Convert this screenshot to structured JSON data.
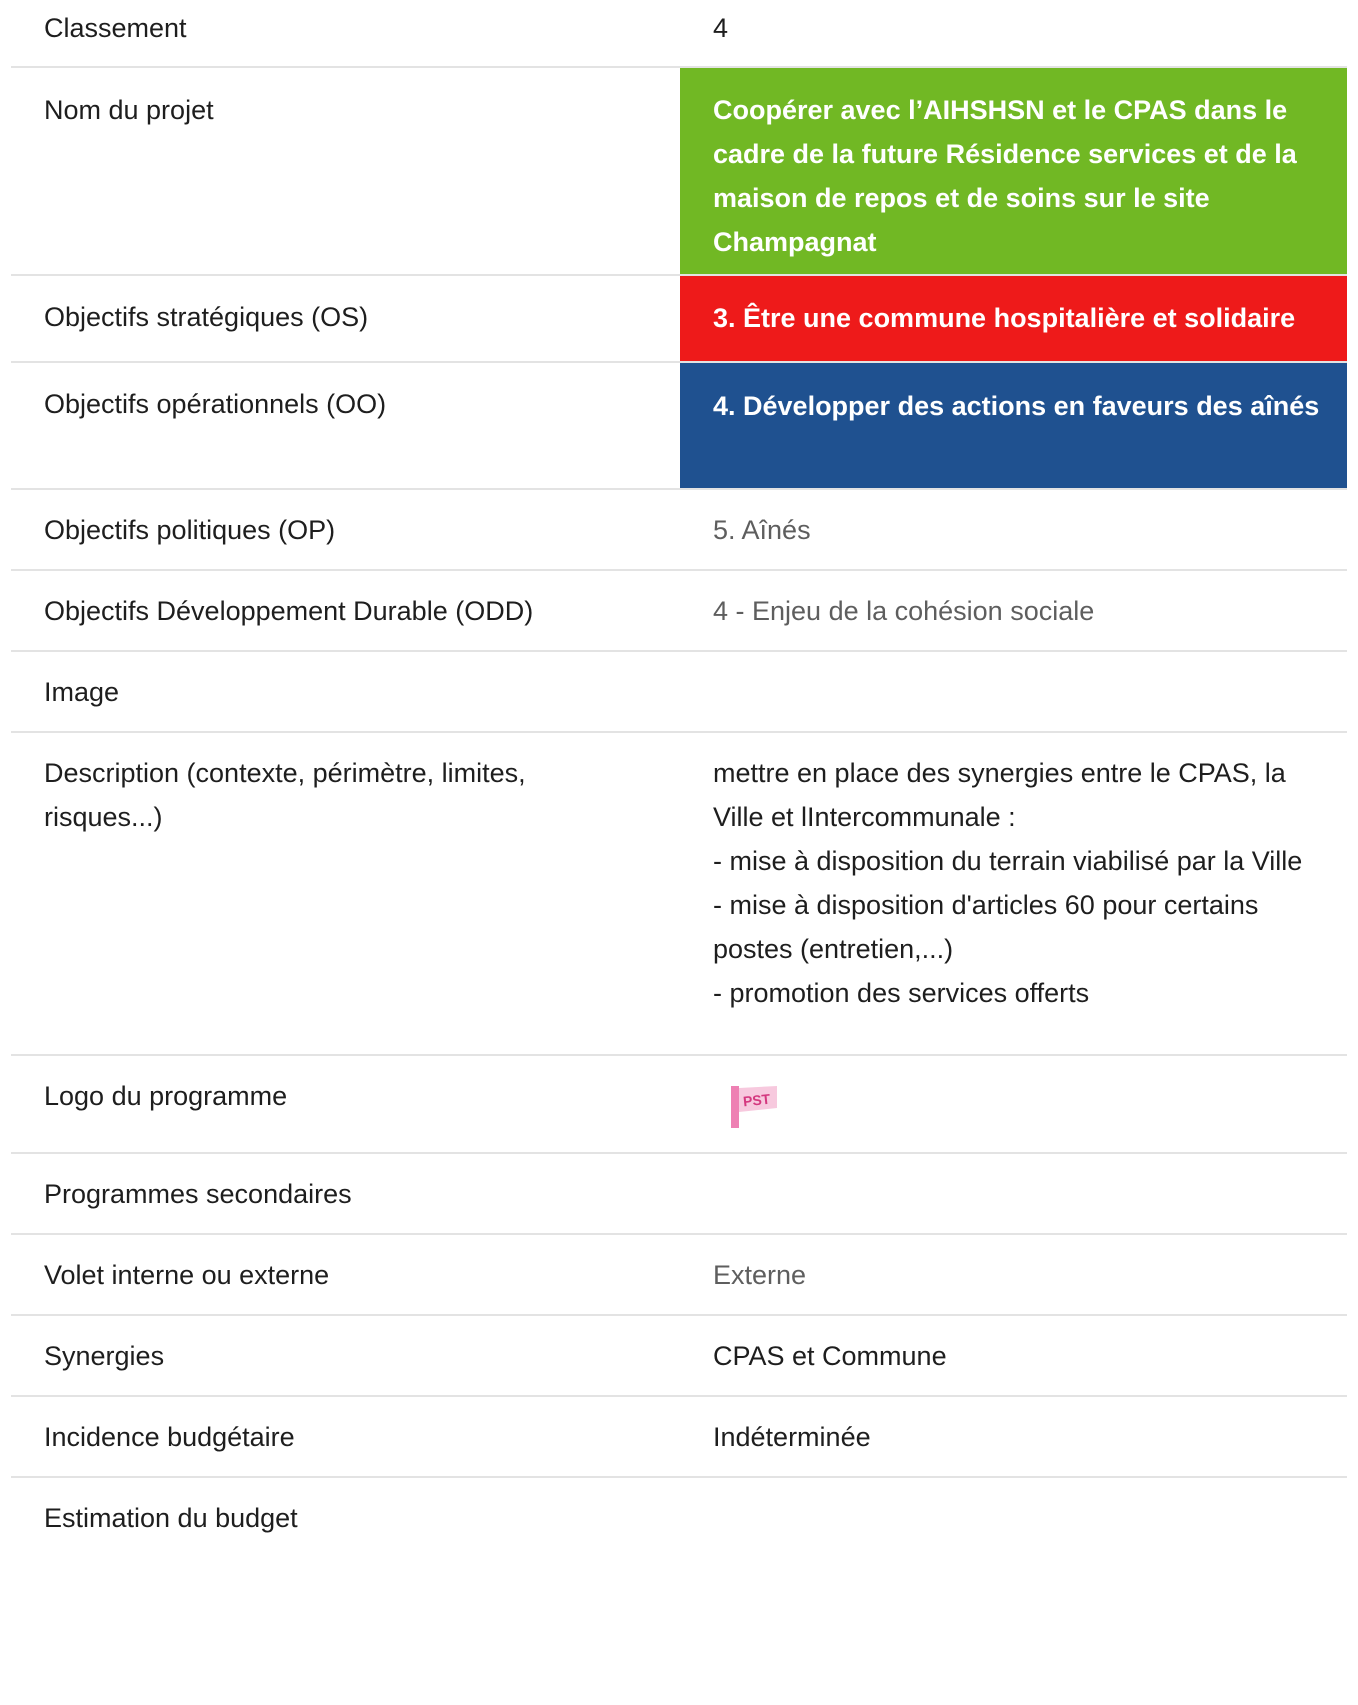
{
  "rows": [
    {
      "label": "Classement",
      "value": "4"
    },
    {
      "label": "Nom du projet",
      "value": "Coopérer avec l’AIHSHSN et le CPAS dans le cadre de la future Résidence services et de la maison de repos et de soins sur le site Champagnat"
    },
    {
      "label": "Objectifs stratégiques (OS)",
      "value": "3. Être une commune hospitalière et solidaire"
    },
    {
      "label": "Objectifs opérationnels (OO)",
      "value": "4. Développer des actions en faveurs des aînés"
    },
    {
      "label": "Objectifs politiques (OP)",
      "value": "5. Aînés"
    },
    {
      "label": "Objectifs Développement Durable (ODD)",
      "value": "4 - Enjeu de la cohésion sociale"
    },
    {
      "label": "Image",
      "value": ""
    },
    {
      "label": "Description (contexte, périmètre, limites, risques...)",
      "value_lines": [
        "mettre en place des synergies entre le CPAS, la Ville et lIntercommunale :",
        "- mise à disposition du terrain viabilisé par la Ville",
        "- mise à disposition d'articles 60 pour certains postes (entretien,...)",
        "- promotion des services offerts"
      ]
    },
    {
      "label": "Logo du programme",
      "logo_text": "PST"
    },
    {
      "label": "Programmes secondaires",
      "value": ""
    },
    {
      "label": "Volet interne ou externe",
      "value": "Externe"
    },
    {
      "label": "Synergies",
      "value": "CPAS et Commune"
    },
    {
      "label": "Incidence budgétaire",
      "value": "Indéterminée"
    },
    {
      "label": "Estimation du budget",
      "value": ""
    }
  ],
  "colors": {
    "project_name_bg": "#71b824",
    "os_bg": "#ee1a1a",
    "oo_bg": "#1f5190",
    "logo_pink": "#e8559a"
  }
}
